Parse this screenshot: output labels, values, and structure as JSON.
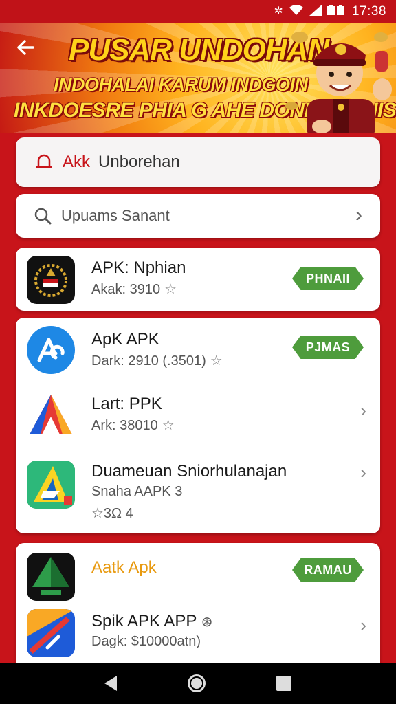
{
  "status_bar": {
    "time": "17:38"
  },
  "banner": {
    "title": "PUSAR UNDOHAN",
    "line2": "INDOHALAI KARUM INDGOIN",
    "line3": "INKDOESRE PHIA G AHE DONNI SAINIS"
  },
  "unboxing": {
    "label_a": "Akk",
    "label_b": "Unborehan"
  },
  "search": {
    "placeholder": "Upuams Sanant"
  },
  "apps": [
    {
      "name": "APK: Nphian",
      "sub": "Akak: 3910",
      "star": "☆",
      "action": "PHNAII"
    },
    {
      "name": "ApK APK",
      "sub": "Dark: 2910 (.3501)",
      "star": "☆",
      "action": "PJMAS"
    },
    {
      "name": "Lart: PPK",
      "sub": "Ark: 38010",
      "star": "☆",
      "action": "›"
    },
    {
      "name": "Duameuan Sniorhulanajan",
      "sub": "Snaha AAPK 3",
      "sub2": "☆3Ω 4",
      "action": "›"
    },
    {
      "name": "Aatk Apk",
      "sub": "",
      "action": "RAMAU"
    },
    {
      "name": "Spik APK APP",
      "name_badge": "⊛",
      "sub": "Dagk: $10000atn)",
      "action": "›"
    }
  ],
  "colors": {
    "brand_red": "#c8141a",
    "button_green": "#4e9c3c",
    "highlight_orange": "#e89a10"
  }
}
